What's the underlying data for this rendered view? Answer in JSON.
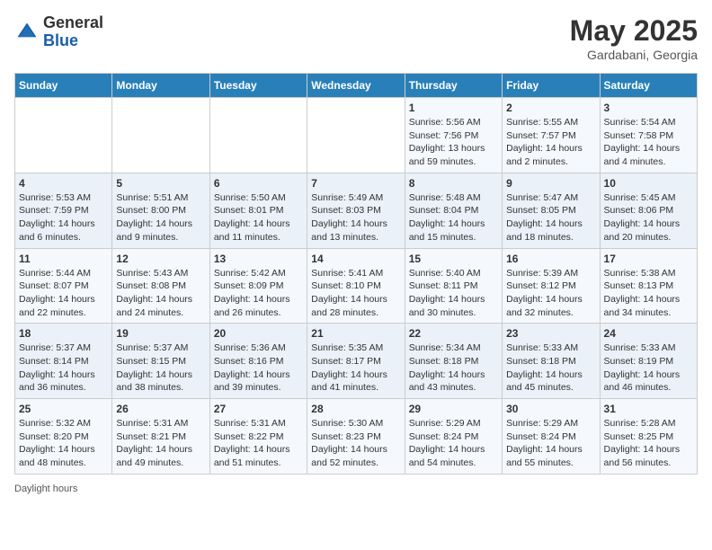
{
  "header": {
    "logo_general": "General",
    "logo_blue": "Blue",
    "title": "May 2025",
    "location": "Gardabani, Georgia"
  },
  "days_of_week": [
    "Sunday",
    "Monday",
    "Tuesday",
    "Wednesday",
    "Thursday",
    "Friday",
    "Saturday"
  ],
  "weeks": [
    [
      {
        "day": "",
        "info": ""
      },
      {
        "day": "",
        "info": ""
      },
      {
        "day": "",
        "info": ""
      },
      {
        "day": "",
        "info": ""
      },
      {
        "day": "1",
        "sunrise": "5:56 AM",
        "sunset": "7:56 PM",
        "daylight": "13 hours and 59 minutes."
      },
      {
        "day": "2",
        "sunrise": "5:55 AM",
        "sunset": "7:57 PM",
        "daylight": "14 hours and 2 minutes."
      },
      {
        "day": "3",
        "sunrise": "5:54 AM",
        "sunset": "7:58 PM",
        "daylight": "14 hours and 4 minutes."
      }
    ],
    [
      {
        "day": "4",
        "sunrise": "5:53 AM",
        "sunset": "7:59 PM",
        "daylight": "14 hours and 6 minutes."
      },
      {
        "day": "5",
        "sunrise": "5:51 AM",
        "sunset": "8:00 PM",
        "daylight": "14 hours and 9 minutes."
      },
      {
        "day": "6",
        "sunrise": "5:50 AM",
        "sunset": "8:01 PM",
        "daylight": "14 hours and 11 minutes."
      },
      {
        "day": "7",
        "sunrise": "5:49 AM",
        "sunset": "8:03 PM",
        "daylight": "14 hours and 13 minutes."
      },
      {
        "day": "8",
        "sunrise": "5:48 AM",
        "sunset": "8:04 PM",
        "daylight": "14 hours and 15 minutes."
      },
      {
        "day": "9",
        "sunrise": "5:47 AM",
        "sunset": "8:05 PM",
        "daylight": "14 hours and 18 minutes."
      },
      {
        "day": "10",
        "sunrise": "5:45 AM",
        "sunset": "8:06 PM",
        "daylight": "14 hours and 20 minutes."
      }
    ],
    [
      {
        "day": "11",
        "sunrise": "5:44 AM",
        "sunset": "8:07 PM",
        "daylight": "14 hours and 22 minutes."
      },
      {
        "day": "12",
        "sunrise": "5:43 AM",
        "sunset": "8:08 PM",
        "daylight": "14 hours and 24 minutes."
      },
      {
        "day": "13",
        "sunrise": "5:42 AM",
        "sunset": "8:09 PM",
        "daylight": "14 hours and 26 minutes."
      },
      {
        "day": "14",
        "sunrise": "5:41 AM",
        "sunset": "8:10 PM",
        "daylight": "14 hours and 28 minutes."
      },
      {
        "day": "15",
        "sunrise": "5:40 AM",
        "sunset": "8:11 PM",
        "daylight": "14 hours and 30 minutes."
      },
      {
        "day": "16",
        "sunrise": "5:39 AM",
        "sunset": "8:12 PM",
        "daylight": "14 hours and 32 minutes."
      },
      {
        "day": "17",
        "sunrise": "5:38 AM",
        "sunset": "8:13 PM",
        "daylight": "14 hours and 34 minutes."
      }
    ],
    [
      {
        "day": "18",
        "sunrise": "5:37 AM",
        "sunset": "8:14 PM",
        "daylight": "14 hours and 36 minutes."
      },
      {
        "day": "19",
        "sunrise": "5:37 AM",
        "sunset": "8:15 PM",
        "daylight": "14 hours and 38 minutes."
      },
      {
        "day": "20",
        "sunrise": "5:36 AM",
        "sunset": "8:16 PM",
        "daylight": "14 hours and 39 minutes."
      },
      {
        "day": "21",
        "sunrise": "5:35 AM",
        "sunset": "8:17 PM",
        "daylight": "14 hours and 41 minutes."
      },
      {
        "day": "22",
        "sunrise": "5:34 AM",
        "sunset": "8:18 PM",
        "daylight": "14 hours and 43 minutes."
      },
      {
        "day": "23",
        "sunrise": "5:33 AM",
        "sunset": "8:18 PM",
        "daylight": "14 hours and 45 minutes."
      },
      {
        "day": "24",
        "sunrise": "5:33 AM",
        "sunset": "8:19 PM",
        "daylight": "14 hours and 46 minutes."
      }
    ],
    [
      {
        "day": "25",
        "sunrise": "5:32 AM",
        "sunset": "8:20 PM",
        "daylight": "14 hours and 48 minutes."
      },
      {
        "day": "26",
        "sunrise": "5:31 AM",
        "sunset": "8:21 PM",
        "daylight": "14 hours and 49 minutes."
      },
      {
        "day": "27",
        "sunrise": "5:31 AM",
        "sunset": "8:22 PM",
        "daylight": "14 hours and 51 minutes."
      },
      {
        "day": "28",
        "sunrise": "5:30 AM",
        "sunset": "8:23 PM",
        "daylight": "14 hours and 52 minutes."
      },
      {
        "day": "29",
        "sunrise": "5:29 AM",
        "sunset": "8:24 PM",
        "daylight": "14 hours and 54 minutes."
      },
      {
        "day": "30",
        "sunrise": "5:29 AM",
        "sunset": "8:24 PM",
        "daylight": "14 hours and 55 minutes."
      },
      {
        "day": "31",
        "sunrise": "5:28 AM",
        "sunset": "8:25 PM",
        "daylight": "14 hours and 56 minutes."
      }
    ]
  ],
  "footer": {
    "label": "Daylight hours"
  }
}
